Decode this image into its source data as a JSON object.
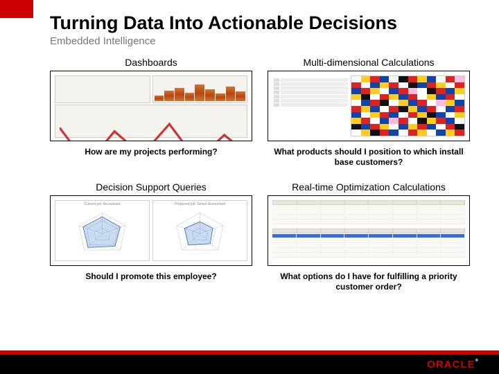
{
  "slide": {
    "title": "Turning Data Into Actionable Decisions",
    "subtitle": "Embedded Intelligence"
  },
  "quadrants": [
    {
      "heading": "Dashboards",
      "question": "How are my projects performing?"
    },
    {
      "heading": "Multi-dimensional Calculations",
      "question": "What products should I position to which install base customers?"
    },
    {
      "heading": "Decision Support Queries",
      "question": "Should I promote this employee?"
    },
    {
      "heading": "Real-time Optimization Calculations",
      "question": "What options do I have for fulfilling a priority customer order?"
    }
  ],
  "radar": {
    "left_label": "Current job: Accountant",
    "right_label": "Proposed job: Senior Accountant"
  },
  "footer": {
    "logo_text": "ORACLE",
    "tm": "®"
  }
}
